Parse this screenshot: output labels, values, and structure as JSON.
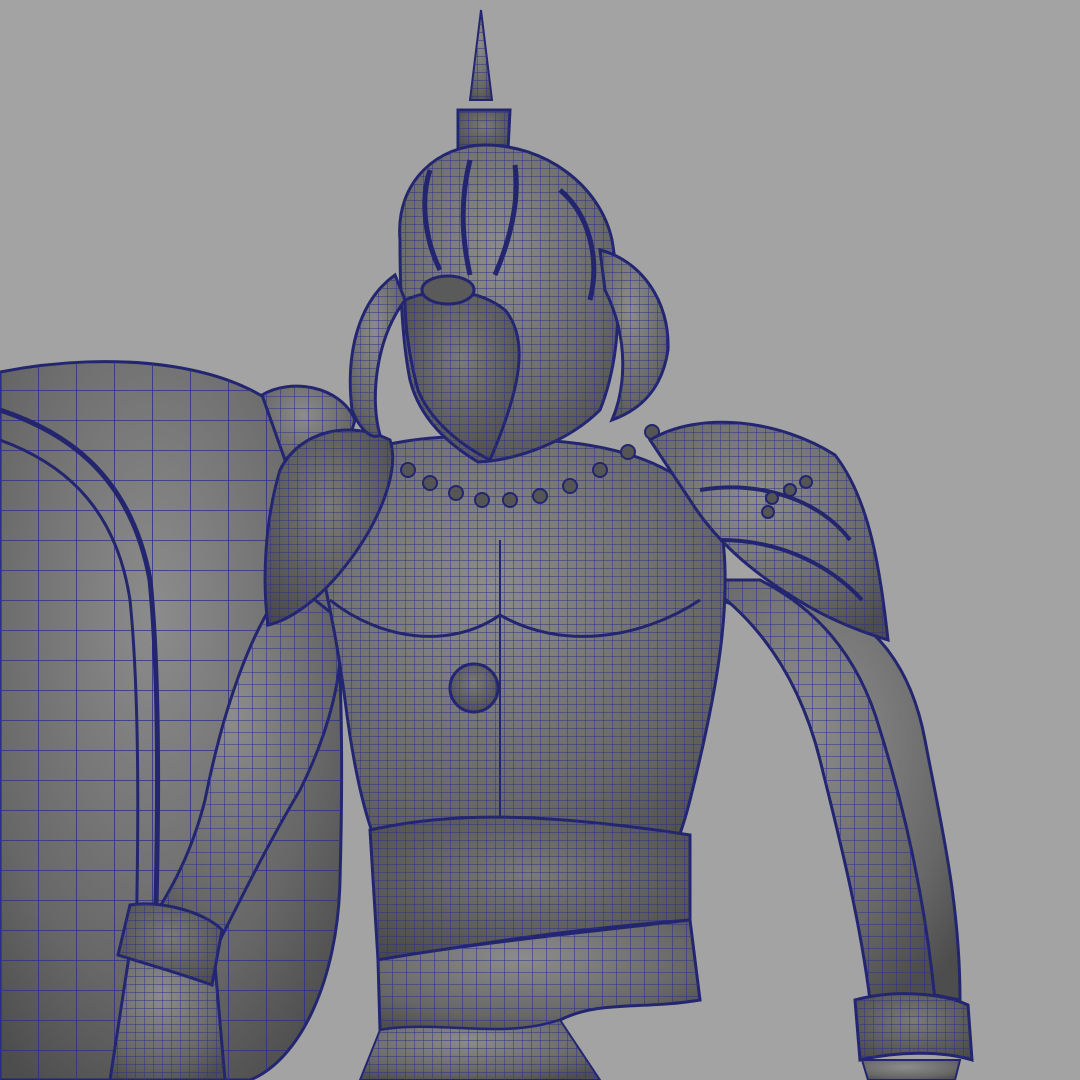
{
  "viewport": {
    "background": "#a3a3a3",
    "wire_color": "#2b2f8f",
    "surface_color": "#6b6b6b",
    "surface_light": "#8a8a8a",
    "surface_dark": "#4a4a4a"
  },
  "scene": {
    "objects": [
      "shield",
      "helmet",
      "torso",
      "left-pauldron",
      "right-pauldron",
      "left-arm",
      "right-arm",
      "belt",
      "left-bracer",
      "right-bracer"
    ]
  }
}
